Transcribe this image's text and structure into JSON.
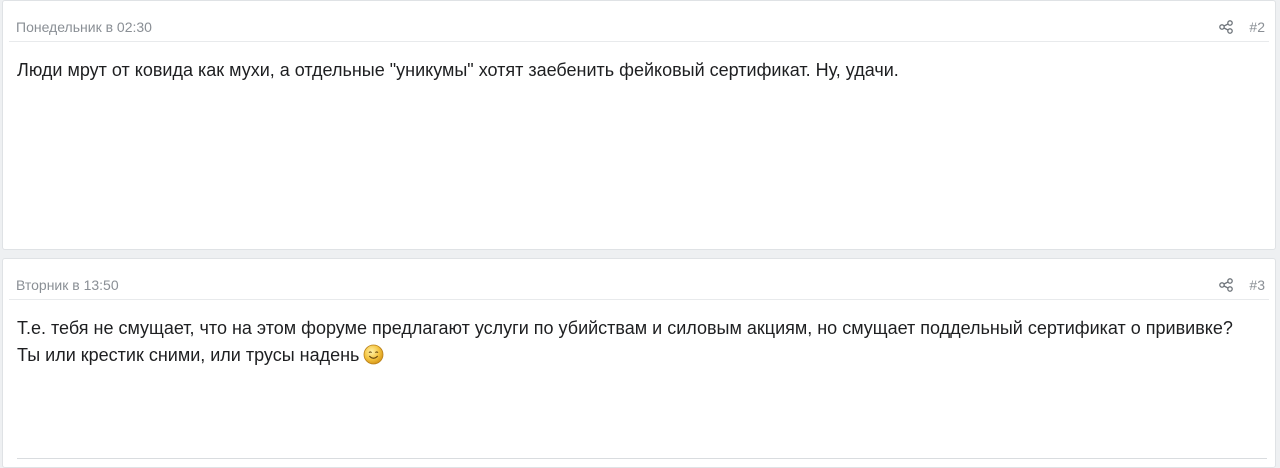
{
  "posts": [
    {
      "date": "Понедельник в 02:30",
      "number": "#2",
      "lines": [
        "Люди мрут от ковида как мухи, а отдельные \"уникумы\" хотят заебенить фейковый сертификат. Ну, удачи."
      ],
      "share_icon": "share-icon"
    },
    {
      "date": "Вторник в 13:50",
      "number": "#3",
      "lines": [
        "Т.е. тебя не смущает, что на этом форуме предлагают услуги по убийствам и силовым акциям, но смущает поддельный сертификат о прививке?",
        "Ты или крестик сними, или трусы надень"
      ],
      "emoji": "smile-emoji",
      "share_icon": "share-icon"
    }
  ],
  "colors": {
    "page_bg": "#eef0f2",
    "post_bg": "#ffffff",
    "meta_text": "#8a8f95",
    "body_text": "#1e1f21",
    "emoji_fill": "#f5c542"
  }
}
